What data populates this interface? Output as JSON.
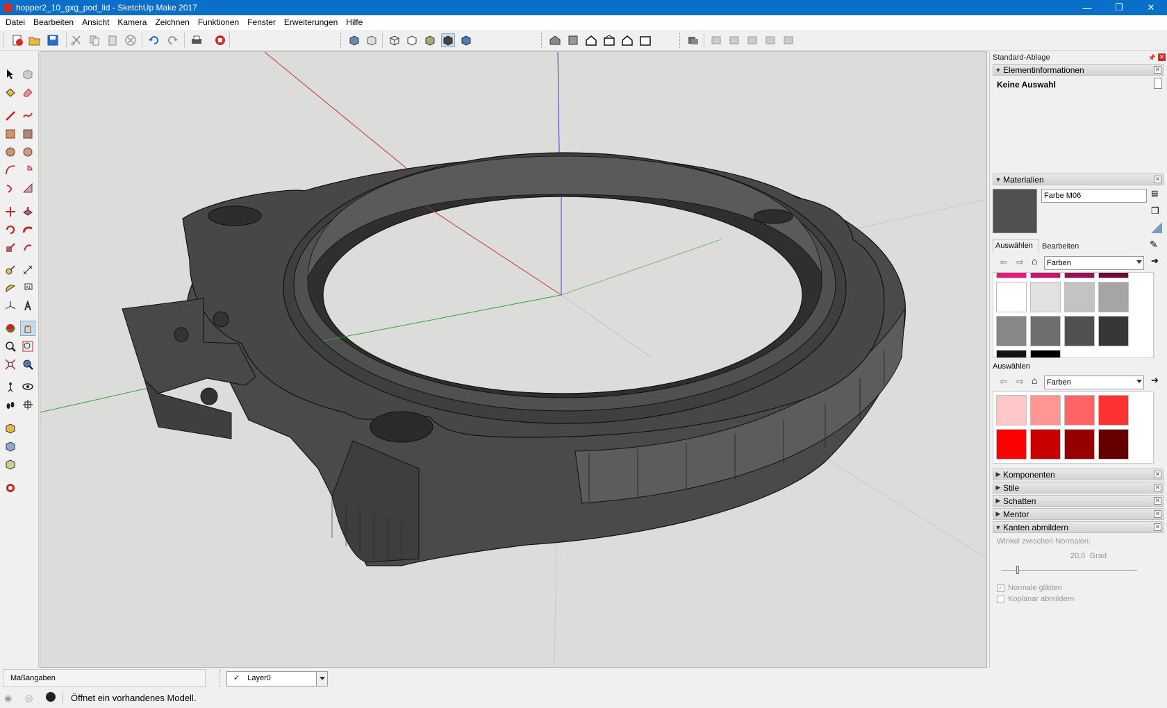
{
  "window": {
    "title": "hopper2_10_gxg_pod_lid - SketchUp Make 2017",
    "buttons": [
      "—",
      "❐",
      "✕"
    ]
  },
  "menu": [
    "Datei",
    "Bearbeiten",
    "Ansicht",
    "Kamera",
    "Zeichnen",
    "Funktionen",
    "Fenster",
    "Erweiterungen",
    "Hilfe"
  ],
  "tray": {
    "title": "Standard-Ablage",
    "entity_info": {
      "header": "Elementinformationen",
      "selection": "Keine Auswahl"
    },
    "materials": {
      "header": "Materialien",
      "current_name": "Farbe M06",
      "current_color": "#505050",
      "tabs": [
        "Auswählen",
        "Bearbeiten"
      ],
      "library_top": "Farben",
      "library_bottom": "Farben",
      "bottom_label": "Auswählen",
      "top_swatches": [
        "#e6197d",
        "#c8146b",
        "#9a0e54",
        "#6e0a3c",
        "#ffffff",
        "#e1e1e1",
        "#c3c3c3",
        "#a5a5a5",
        "#878787",
        "#6e6e6e",
        "#505050",
        "#373737",
        "#141414",
        "#000000"
      ],
      "bottom_swatches": [
        "#ffc8c8",
        "#ff9696",
        "#ff6464",
        "#ff3232",
        "#ff0000",
        "#c80000",
        "#960000",
        "#640000"
      ]
    },
    "collapsed": [
      "Komponenten",
      "Stile",
      "Schatten",
      "Mentor"
    ],
    "soften": {
      "header": "Kanten abmildern",
      "angle_label": "Winkel zwischen Normalen:",
      "angle_value": "20,0",
      "angle_unit": "Grad",
      "slider_fraction": 0.11,
      "smooth_normals": "Normale glätten",
      "smooth_normals_checked": true,
      "soften_coplanar": "Koplanar abmildern",
      "soften_coplanar_checked": false
    }
  },
  "status": {
    "measurements_label": "Maßangaben",
    "layer": "Layer0",
    "message": "Öffnet ein vorhandenes Modell."
  },
  "colors": {
    "titlebar": "#0a6fc9",
    "model": "#4e4e4e",
    "axis_red": "#c83232",
    "axis_green": "#32a032",
    "axis_blue": "#3232c8"
  },
  "icons": {
    "toolbar": [
      "new-icon",
      "open-icon",
      "save-icon",
      "cut-icon",
      "copy-icon",
      "paste-icon",
      "erase-icon",
      "undo-icon",
      "redo-icon",
      "print-icon",
      "model-info-icon",
      "xray-icon",
      "back-edges-icon",
      "wireframe-icon",
      "hidden-line-icon",
      "shaded-icon",
      "shaded-textures-icon",
      "monochrome-icon",
      "iso-view-icon",
      "top-view-icon",
      "front-view-icon",
      "right-view-icon",
      "back-view-icon",
      "left-view-icon",
      "section-plane-icon"
    ],
    "left": [
      "select-icon",
      "make-component-icon",
      "paint-bucket-icon",
      "eraser-icon",
      "line-icon",
      "freehand-icon",
      "rectangle-icon",
      "rotated-rectangle-icon",
      "circle-icon",
      "polygon-icon",
      "arc-icon",
      "pie-icon",
      "two-point-arc-icon",
      "three-point-arc-icon",
      "move-icon",
      "push-pull-icon",
      "rotate-icon",
      "follow-me-icon",
      "scale-icon",
      "offset-icon",
      "tape-measure-icon",
      "dimension-icon",
      "protractor-icon",
      "text-icon",
      "axes-icon",
      "3d-text-icon",
      "orbit-icon",
      "pan-icon",
      "zoom-icon",
      "zoom-window-icon",
      "zoom-extents-icon",
      "previous-icon",
      "position-camera-icon",
      "look-around-icon",
      "walk-icon",
      "section-plane-icon",
      "warehouse-icon",
      "extension-warehouse-icon",
      "share-model-icon",
      "extensions-icon"
    ]
  }
}
